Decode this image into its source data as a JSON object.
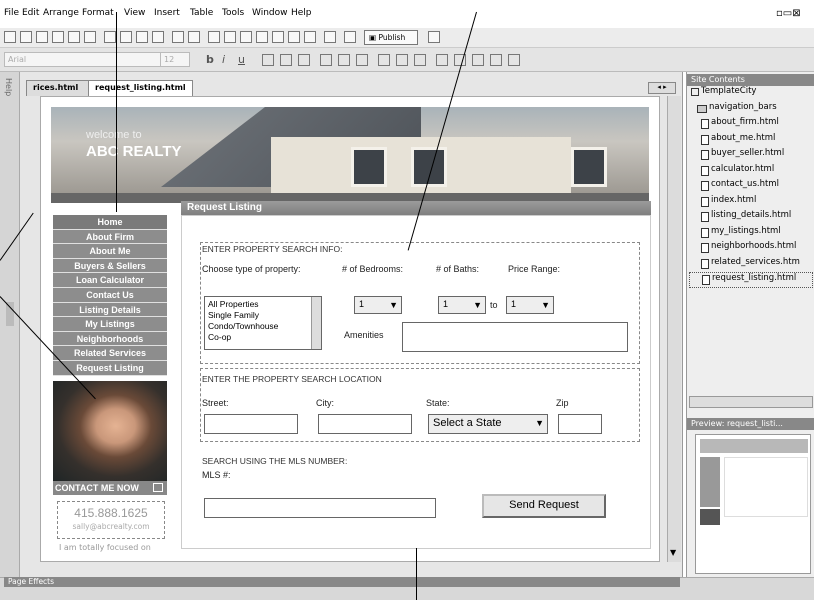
{
  "menu": [
    "File",
    "Edit",
    "Arrange",
    "Format",
    "View",
    "Insert",
    "Table",
    "Tools",
    "Window",
    "Help"
  ],
  "toolbar": {
    "publish_label": "Publish"
  },
  "format_bar": {
    "font_value": "Arial",
    "size_value": "12",
    "bold": "b",
    "italic": "i",
    "underline": "u"
  },
  "left_strip_label": "Help",
  "tabs": [
    "rices.html",
    "request_listing.html"
  ],
  "site_panel": {
    "title": "Site Contents",
    "root": "TemplateCity",
    "folder": "navigation_bars",
    "files": [
      "about_firm.html",
      "about_me.html",
      "buyer_seller.html",
      "calculator.html",
      "contact_us.html",
      "index.html",
      "listing_details.html",
      "my_listings.html",
      "neighborhoods.html",
      "related_services.htm",
      "request_listing.html"
    ],
    "preview_title": "Preview: request_listi..."
  },
  "status_label": "Page Effects",
  "page": {
    "welcome": "welcome to",
    "brand": "ABC REALTY",
    "nav": [
      "Home",
      "About Firm",
      "About Me",
      "Buyers & Sellers",
      "Loan Calculator",
      "Contact Us",
      "Listing Details",
      "My Listings",
      "Neighborhoods",
      "Related Services",
      "Request Listing"
    ],
    "contact_label": "CONTACT ME NOW",
    "phone": "415.888.1625",
    "email": "sally@abcrealty.com",
    "tagline": "I am totally focused on",
    "form_title": "Request Listing",
    "section1": "ENTER PROPERTY SEARCH INFO:",
    "type_label": "Choose type of property:",
    "bedrooms_label": "# of Bedrooms:",
    "baths_label": "# of Baths:",
    "price_label": "Price Range:",
    "property_types": [
      "All Properties",
      "Single Family",
      "Condo/Townhouse",
      "Co-op"
    ],
    "bedrooms_value": "1",
    "price_from": "1",
    "to_label": "to",
    "price_to": "1",
    "amenities_label": "Amenities",
    "section2": "ENTER THE PROPERTY SEARCH LOCATION",
    "street_label": "Street:",
    "city_label": "City:",
    "state_label": "State:",
    "zip_label": "Zip",
    "state_value": "Select a State",
    "section3": "SEARCH USING THE MLS NUMBER:",
    "mls_label": "MLS #:",
    "submit_label": "Send Request"
  }
}
